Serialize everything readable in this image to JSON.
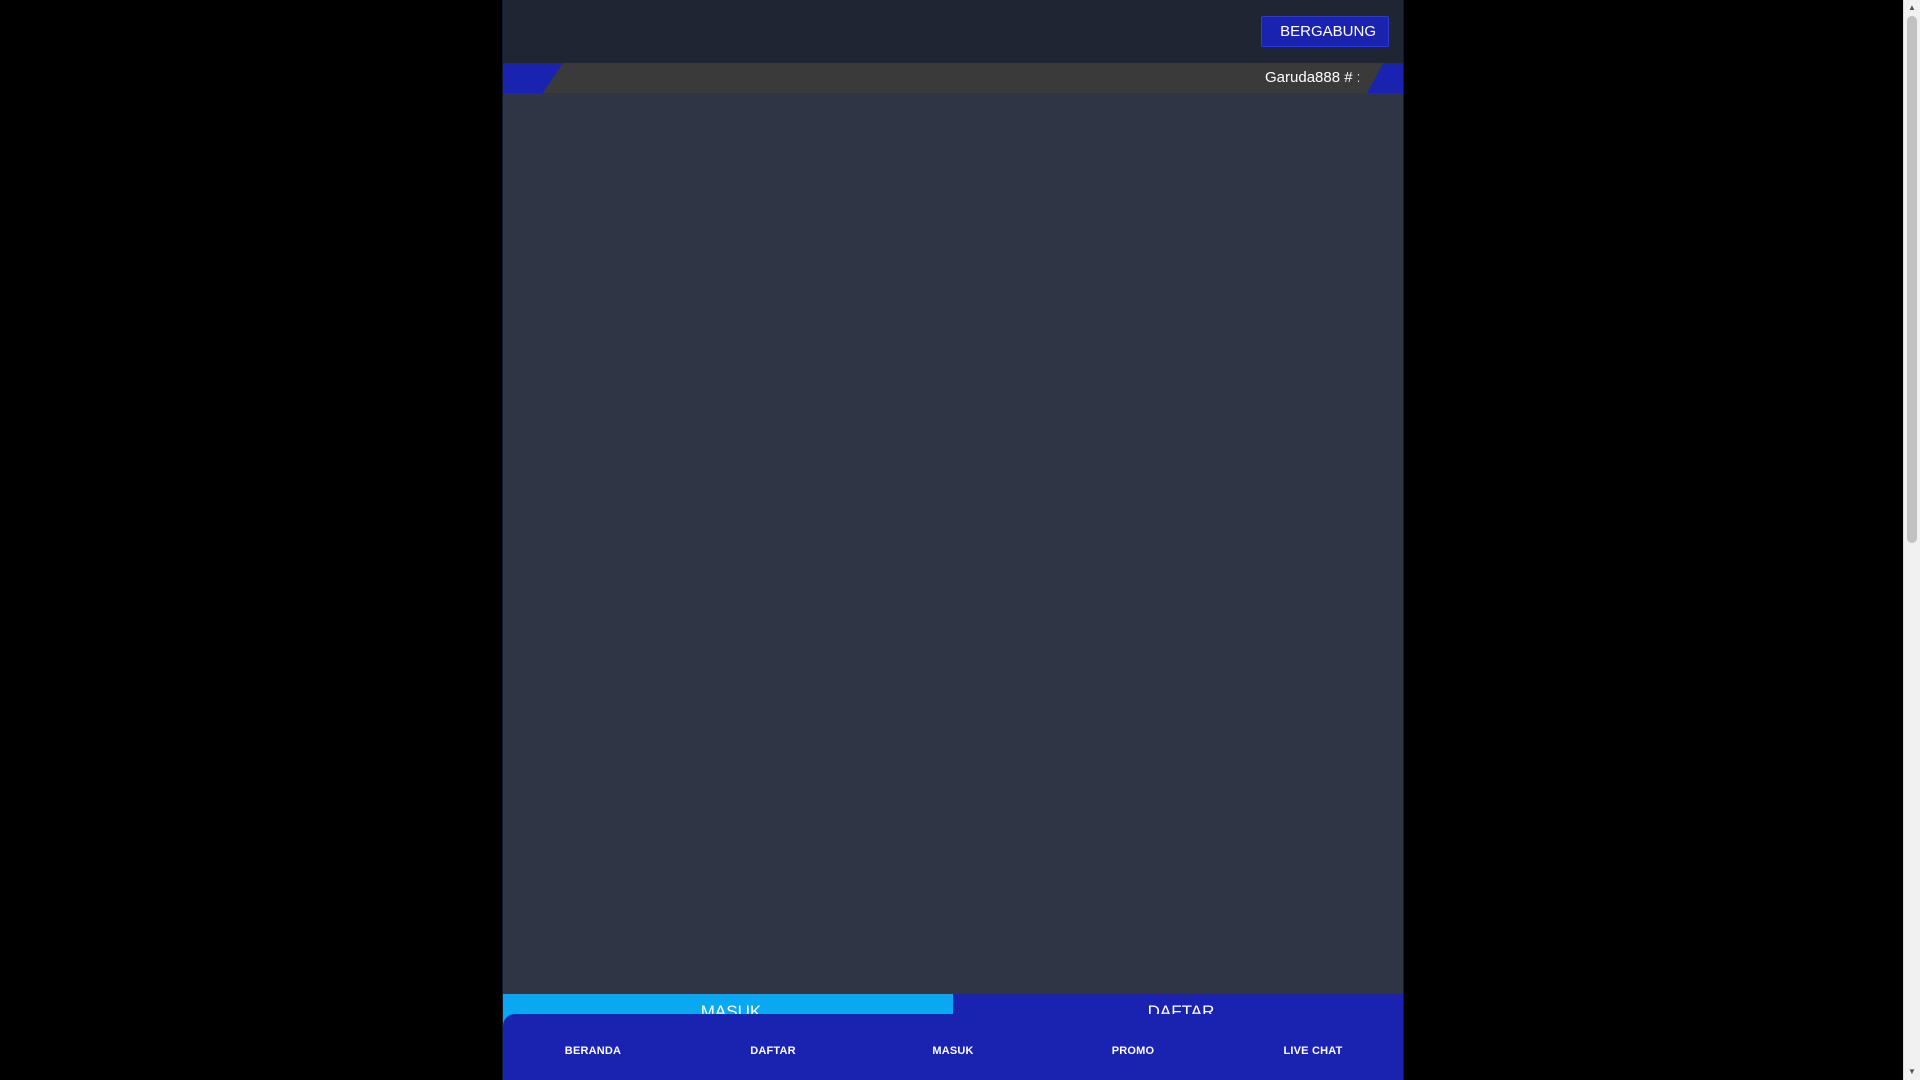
{
  "header": {
    "join_label": "BERGABUNG",
    "join_icon": ""
  },
  "ticker": {
    "speaker_icon": "",
    "text": "Garuda888 # :"
  },
  "auth": {
    "login_icon": "",
    "login_label": "MASUK",
    "register_icon": "",
    "register_label": "DAFTAR"
  },
  "bottom_nav": {
    "items": [
      {
        "icon": "",
        "label": "BERANDA"
      },
      {
        "icon": "",
        "label": "DAFTAR"
      },
      {
        "icon": "",
        "label": "MASUK"
      },
      {
        "icon": "",
        "label": "PROMO"
      },
      {
        "icon": "",
        "label": "LIVE CHAT"
      }
    ]
  },
  "colors": {
    "page_background": "#000000",
    "container_background": "#2f3545",
    "header_background": "#1f2532",
    "primary_blue": "#1a22b0",
    "login_blue": "#0aa7f2",
    "ticker_background": "#3a3a3a"
  }
}
